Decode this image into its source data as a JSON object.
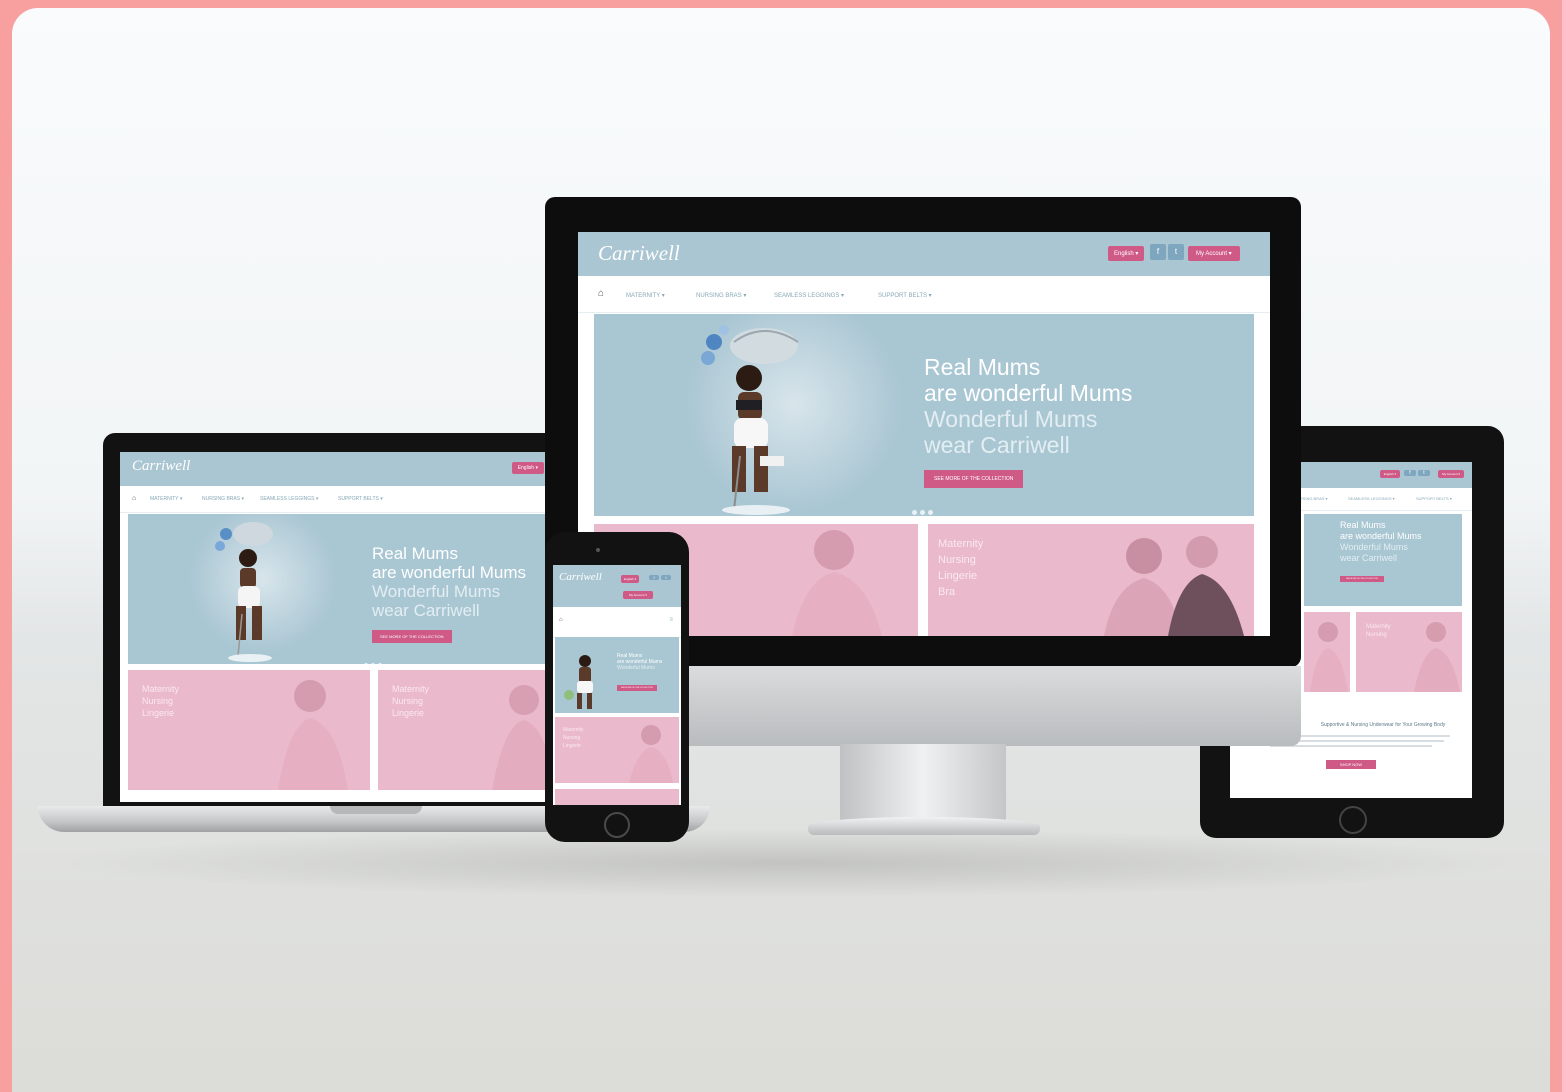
{
  "site": {
    "logo": "Carriwell",
    "header_buttons": {
      "language": "English ▾",
      "cart": "My Account ▾",
      "social": [
        "f",
        "t"
      ]
    },
    "nav": [
      "MATERNITY ▾",
      "NURSING BRAS ▾",
      "SEAMLESS LEGGINGS ▾",
      "SUPPORT BELTS ▾"
    ],
    "hero": {
      "line1": "Real Mums",
      "line2": "are wonderful Mums",
      "line3": "Wonderful Mums",
      "line4": "wear Carriwell",
      "cta": "SEE MORE OF THE COLLECTION"
    },
    "tiles": [
      {
        "text": [
          "Maternity",
          "Nursing",
          "Lingerie"
        ]
      },
      {
        "text": [
          "Maternity",
          "Nursing",
          "Lingerie",
          "Bra"
        ]
      }
    ],
    "tablet_section": {
      "heading": "Supportive & Nursing Underwear for Your Growing Body",
      "button": "SHOP NOW"
    }
  },
  "colors": {
    "brand_pink": "#cf5a86",
    "hero_blue": "#a9c6d3",
    "tile_pink": "#eab9cb",
    "frame_coral": "#f8a09f"
  },
  "icons": [
    "home-icon",
    "facebook-icon",
    "twitter-icon"
  ]
}
